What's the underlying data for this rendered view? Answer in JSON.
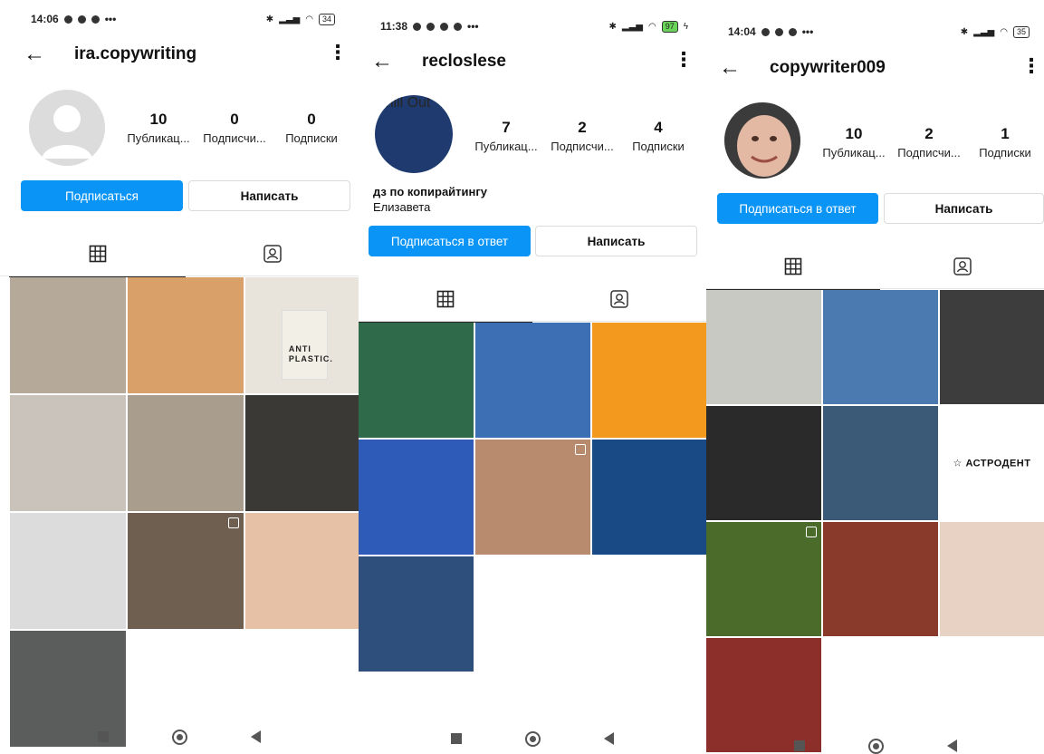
{
  "screens": [
    {
      "status": {
        "time": "14:06",
        "dots": "•••",
        "battery": "34"
      },
      "username": "ira.copywriting",
      "stats": [
        {
          "value": "10",
          "label": "Публикац..."
        },
        {
          "value": "0",
          "label": "Подписчи..."
        },
        {
          "value": "0",
          "label": "Подписки"
        }
      ],
      "buttons": {
        "primary": "Подписаться",
        "secondary": "Написать"
      },
      "grid_colors": [
        "#b5a99a",
        "#d9a06a",
        "#e8e4dc",
        "#c9c3bb",
        "#a99d8e",
        "#3b3936",
        "#dcdcdc",
        "#6f5f50",
        "#e7c1a6",
        "#5a5d5b"
      ],
      "bag_text": [
        "ANTI",
        "PLASTIC."
      ]
    },
    {
      "status": {
        "time": "11:38",
        "dots": "•••",
        "battery": "97"
      },
      "username": "recloslese",
      "avatar_text": "Chill Out",
      "stats": [
        {
          "value": "7",
          "label": "Публикац..."
        },
        {
          "value": "2",
          "label": "Подписчи..."
        },
        {
          "value": "4",
          "label": "Подписки"
        }
      ],
      "bio": {
        "line1": "дз по копирайтингу",
        "line2": "Елизавета"
      },
      "buttons": {
        "primary": "Подписаться в ответ",
        "secondary": "Написать"
      },
      "grid_colors": [
        "#2f6a4a",
        "#3c6fb4",
        "#f39a1e",
        "#2e5bb8",
        "#b88b6e",
        "#1a4a86",
        "#2e4f7c"
      ]
    },
    {
      "status": {
        "time": "14:04",
        "dots": "•••",
        "battery": "35"
      },
      "username": "copywriter009",
      "stats": [
        {
          "value": "10",
          "label": "Публикац..."
        },
        {
          "value": "2",
          "label": "Подписчи..."
        },
        {
          "value": "1",
          "label": "Подписки"
        }
      ],
      "buttons": {
        "primary": "Подписаться в ответ",
        "secondary": "Написать"
      },
      "grid_colors": [
        "#c9c9c4",
        "#4a7ab0",
        "#3d3d3d",
        "#2a2a2a",
        "#3b5a78",
        "#ffffff",
        "#4a6b2a",
        "#8a3a2a",
        "#e7d2c3",
        "#8c2f2a"
      ],
      "brand_text": "☆ АСТРОДЕНТ"
    }
  ]
}
